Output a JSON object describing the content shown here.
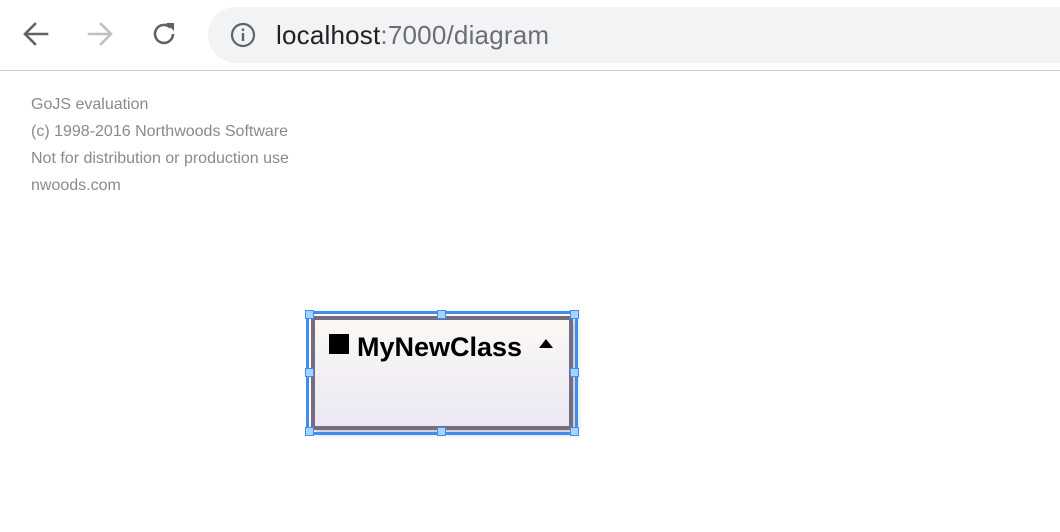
{
  "browser": {
    "url_host": "localhost",
    "url_path": ":7000/diagram"
  },
  "watermark": {
    "lines": [
      "GoJS evaluation",
      "(c) 1998-2016 Northwoods Software",
      "Not for distribution or production use",
      "nwoods.com"
    ]
  },
  "diagram": {
    "node": {
      "title": "MyNewClass",
      "selected": true
    }
  },
  "colors": {
    "node_border": "#756c7f",
    "selection": "#3f8df0",
    "handle_fill": "#a9d4fa",
    "watermark_text": "#8a8a8a"
  }
}
